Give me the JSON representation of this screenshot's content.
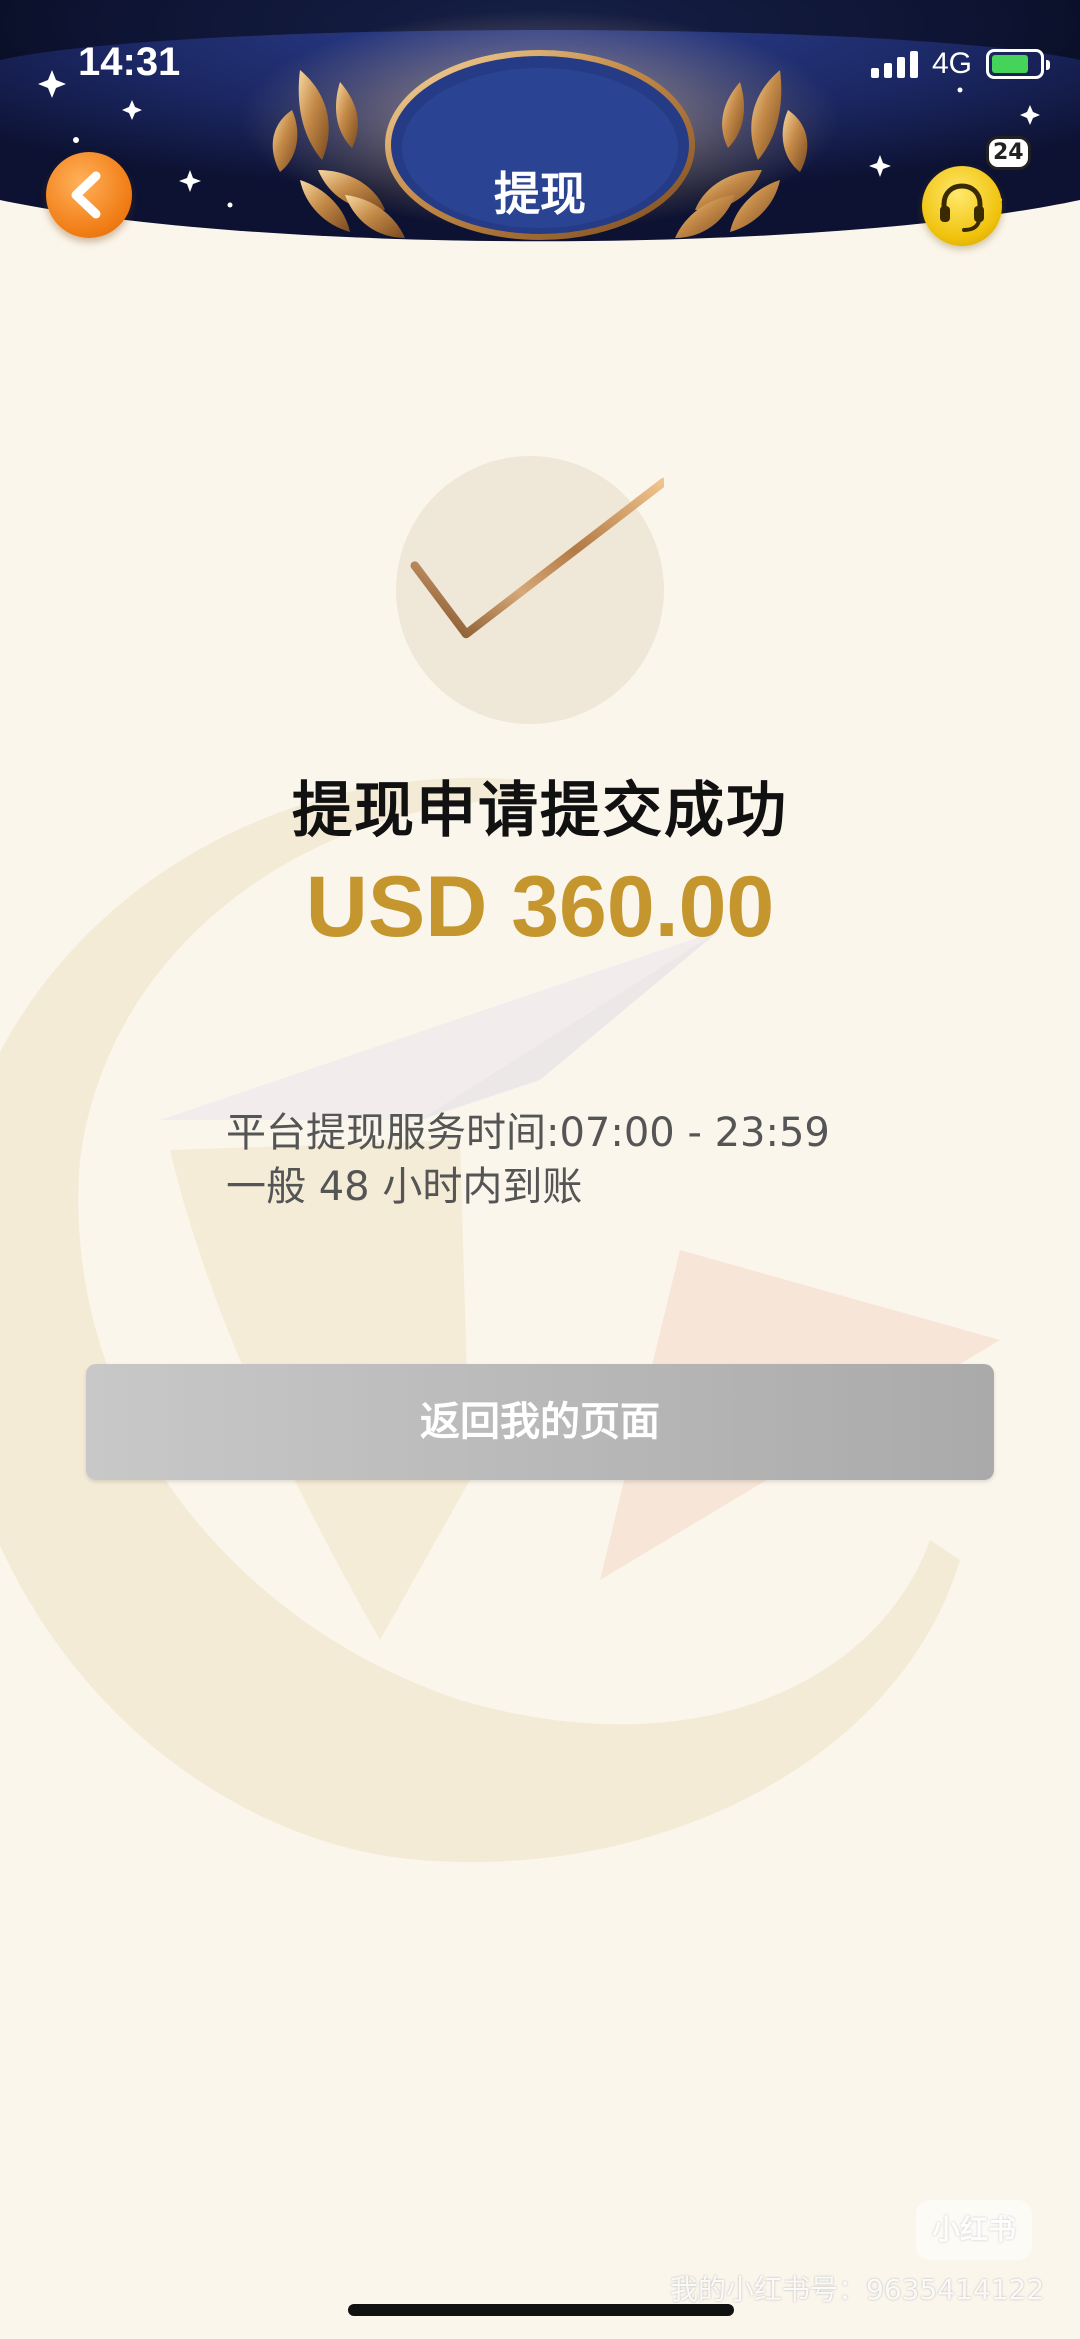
{
  "status_bar": {
    "time": "14:31",
    "network": "4G",
    "battery_level": 0.7
  },
  "header": {
    "title": "提现",
    "message_count": "24"
  },
  "result": {
    "title": "提现申请提交成功",
    "amount": "USD 360.00",
    "amount_color": "#c4962d"
  },
  "notice": {
    "line1": "平台提现服务时间:07:00 - 23:59",
    "line2": "一般 48 小时内到账"
  },
  "actions": {
    "return_label": "返回我的页面"
  },
  "watermark": {
    "badge": "小红书",
    "text": "我的小红书号：9635414122"
  },
  "colors": {
    "background": "#fbf6ec",
    "header": "#1c2a6e",
    "back_button": "#f07a12",
    "service_button": "#f0c20c",
    "return_button": "#b4b4b4"
  },
  "icons": {
    "back": "chevron-left-icon",
    "service": "headset-icon",
    "success": "checkmark-icon"
  }
}
